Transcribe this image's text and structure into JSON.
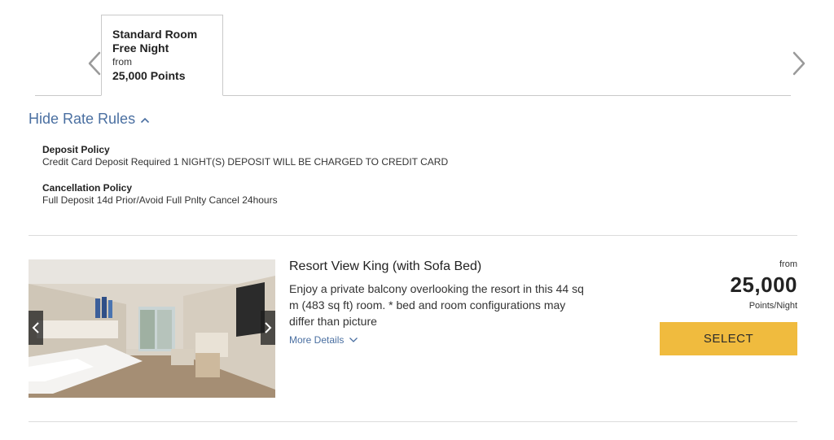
{
  "rate_tabs": {
    "active": {
      "title_line1": "Standard Room",
      "title_line2": "Free Night",
      "from_label": "from",
      "points": "25,000 Points"
    },
    "prev_icon": "chevron-left-icon",
    "next_icon": "chevron-right-icon"
  },
  "rate_rules": {
    "toggle_label": "Hide Rate Rules",
    "toggle_icon": "chevron-up-icon",
    "deposit": {
      "title": "Deposit Policy",
      "text": "Credit Card Deposit Required 1 NIGHT(S) DEPOSIT WILL BE CHARGED TO CREDIT CARD"
    },
    "cancellation": {
      "title": "Cancellation Policy",
      "text": "Full Deposit 14d Prior/Avoid Full Pnlty Cancel 24hours"
    }
  },
  "room": {
    "name": "Resort View King (with Sofa Bed)",
    "description": "Enjoy a private balcony overlooking the resort in this 44 sq m (483 sq ft) room. * bed and room configurations may differ than picture",
    "more_details_label": "More Details",
    "more_details_icon": "chevron-down-icon",
    "photo_prev_icon": "chevron-left-icon",
    "photo_next_icon": "chevron-right-icon",
    "price": {
      "from_label": "from",
      "amount": "25,000",
      "unit": "Points/Night"
    },
    "select_label": "SELECT"
  },
  "colors": {
    "link_blue": "#4a6fa1",
    "select_yellow": "#f0bb3e",
    "border_gray": "#c9c9c9"
  }
}
